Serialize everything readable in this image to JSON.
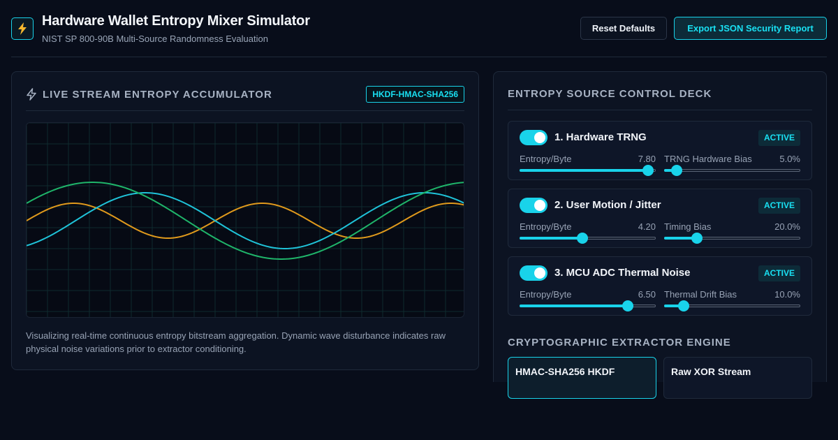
{
  "header": {
    "title": "Hardware Wallet Entropy Mixer Simulator",
    "subtitle": "NIST SP 800-90B Multi-Source Randomness Evaluation",
    "logo_icon": "lightning-bolt-icon",
    "reset_label": "Reset Defaults",
    "export_label": "Export JSON Security Report"
  },
  "colors": {
    "accent": "#19d3ea",
    "wave_cyan": "#1fc3d8",
    "wave_orange": "#e09a1c",
    "wave_green": "#1fb56a"
  },
  "accumulator": {
    "title": "LIVE STREAM ENTROPY ACCUMULATOR",
    "icon": "lightning-bolt-icon",
    "badge": "HKDF-HMAC-SHA256",
    "description": "Visualizing real-time continuous entropy bitstream aggregation. Dynamic wave disturbance indicates raw physical noise variations prior to extractor conditioning."
  },
  "control_deck": {
    "title": "ENTROPY SOURCE CONTROL DECK",
    "sources": [
      {
        "name": "1. Hardware TRNG",
        "enabled": true,
        "status": "ACTIVE",
        "entropy_label": "Entropy/Byte",
        "entropy_value": "7.80",
        "entropy_level": 0.95,
        "bias_label": "TRNG Hardware Bias",
        "bias_value": "5.0%",
        "bias_level": 0.09
      },
      {
        "name": "2. User Motion / Jitter",
        "enabled": true,
        "status": "ACTIVE",
        "entropy_label": "Entropy/Byte",
        "entropy_value": "4.20",
        "entropy_level": 0.46,
        "bias_label": "Timing Bias",
        "bias_value": "20.0%",
        "bias_level": 0.24
      },
      {
        "name": "3. MCU ADC Thermal Noise",
        "enabled": true,
        "status": "ACTIVE",
        "entropy_label": "Entropy/Byte",
        "entropy_value": "6.50",
        "entropy_level": 0.8,
        "bias_label": "Thermal Drift Bias",
        "bias_value": "10.0%",
        "bias_level": 0.14
      }
    ]
  },
  "extractor": {
    "title": "CRYPTOGRAPHIC EXTRACTOR ENGINE",
    "options": [
      {
        "label": "HMAC-SHA256 HKDF",
        "selected": true
      },
      {
        "label": "Raw XOR Stream",
        "selected": false
      }
    ]
  }
}
